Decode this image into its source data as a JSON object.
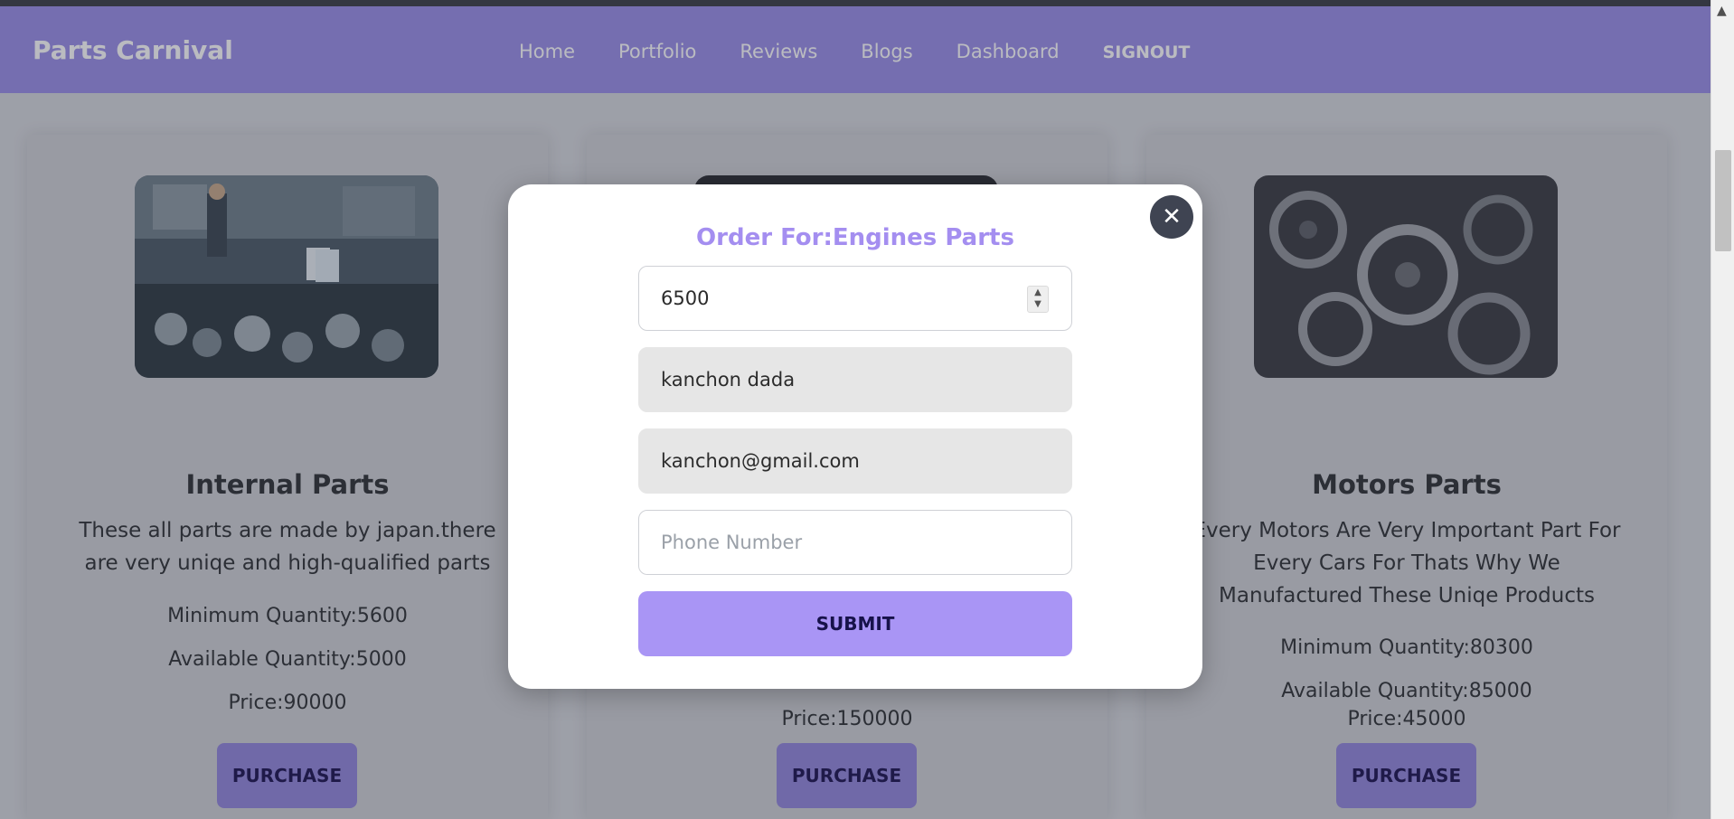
{
  "header": {
    "brand": "Parts Carnival",
    "nav": [
      "Home",
      "Portfolio",
      "Reviews",
      "Blogs",
      "Dashboard"
    ],
    "signout": "SIGNOUT"
  },
  "cards": [
    {
      "title": "Internal Parts",
      "desc": "These all parts are made by japan.there are very uniqe and high-qualified parts",
      "min_qty": "Minimum Quantity:5600",
      "avail_qty": "Available Quantity:5000",
      "price": "Price:90000",
      "button": "PURCHASE"
    },
    {
      "price": "Price:150000",
      "button": "PURCHASE"
    },
    {
      "title": "Motors Parts",
      "desc": "Every Motors Are Very Important Part For Every Cars For Thats Why We Manufactured These Uniqe Products",
      "min_qty": "Minimum Quantity:80300",
      "avail_qty": "Available Quantity:85000",
      "price": "Price:45000",
      "button": "PURCHASE"
    }
  ],
  "modal": {
    "title": "Order For:Engines Parts",
    "quantity_value": "6500",
    "name_value": "kanchon dada",
    "email_value": "kanchon@gmail.com",
    "phone_placeholder": "Phone Number",
    "submit": "SUBMIT",
    "close_icon": "close-icon"
  },
  "colors": {
    "navbar": "#9a8ee8",
    "accent_title": "#a48ef0",
    "submit_bg": "#a995f5",
    "purchase_bg": "#9386dc"
  }
}
